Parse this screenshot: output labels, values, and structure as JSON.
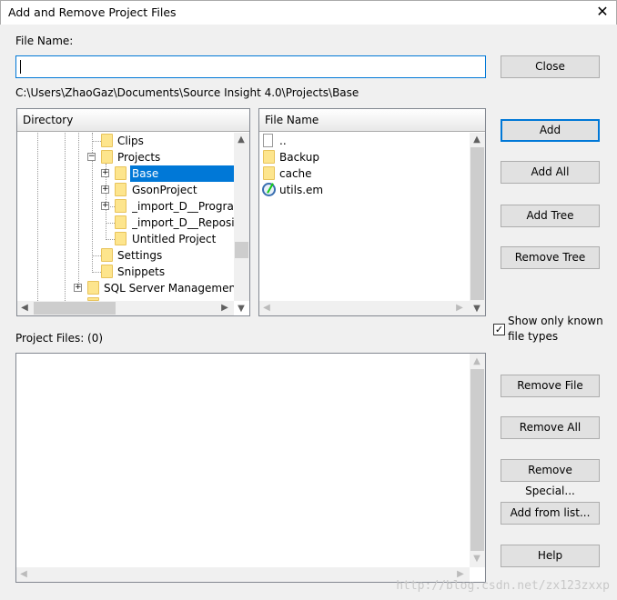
{
  "window": {
    "title": "Add and Remove Project Files",
    "close_icon": "close-icon"
  },
  "file_name": {
    "label": "File Name:",
    "value": ""
  },
  "path": "C:\\Users\\ZhaoGaz\\Documents\\Source Insight 4.0\\Projects\\Base",
  "directory": {
    "header": "Directory",
    "items": [
      {
        "label": "Clips"
      },
      {
        "label": "Projects",
        "expanded": true
      },
      {
        "label": "Base",
        "selected": true
      },
      {
        "label": "GsonProject"
      },
      {
        "label": "_import_D__Program"
      },
      {
        "label": "_import_D__Reposit"
      },
      {
        "label": "Untitled Project"
      },
      {
        "label": "Settings"
      },
      {
        "label": "Snippets"
      },
      {
        "label": "SQL Server Management"
      }
    ]
  },
  "files": {
    "header": "File Name",
    "items": [
      {
        "label": "..",
        "icon": "file-icon"
      },
      {
        "label": "Backup",
        "icon": "folder-icon"
      },
      {
        "label": "cache",
        "icon": "folder-icon"
      },
      {
        "label": "utils.em",
        "icon": "macro-file-icon"
      }
    ]
  },
  "buttons": {
    "close": "Close",
    "add": "Add",
    "add_all": "Add All",
    "add_tree": "Add Tree",
    "remove_tree": "Remove Tree",
    "remove_file": "Remove File",
    "remove_all": "Remove All",
    "remove_special": "Remove Special...",
    "add_from_list": "Add from list...",
    "help": "Help"
  },
  "show_known": {
    "label_line1": "Show only known",
    "label_line2": "file types",
    "checked": true
  },
  "project_files": {
    "label": "Project Files: (0)"
  },
  "watermark": "http://blog.csdn.net/zx123zxxp"
}
